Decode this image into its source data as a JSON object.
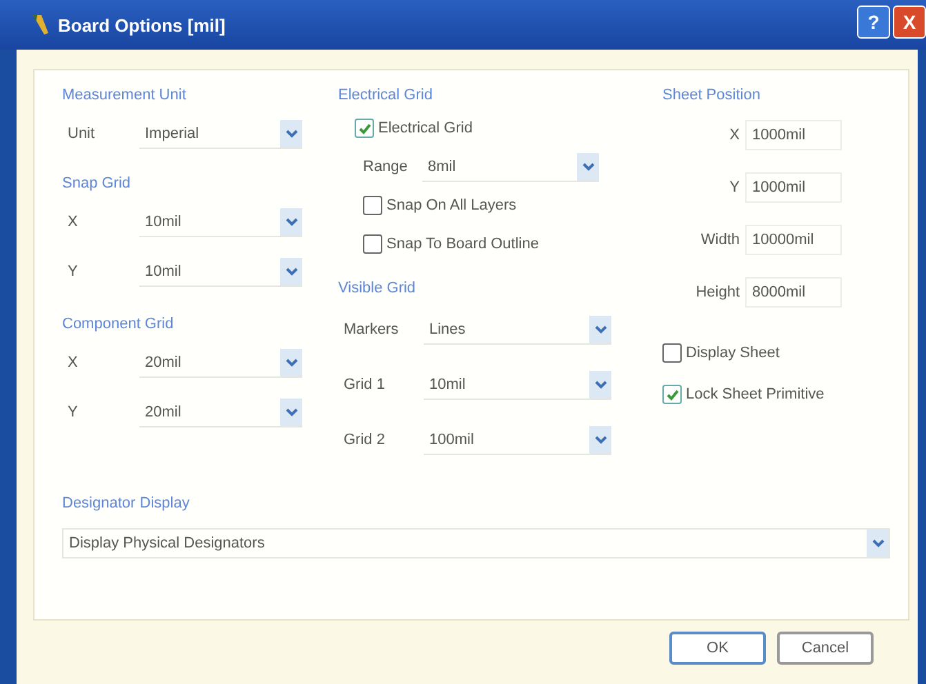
{
  "window": {
    "title": "Board Options [mil]",
    "buttons": [
      {
        "kind": "help",
        "label": "?"
      },
      {
        "kind": "close",
        "label": "X"
      }
    ]
  },
  "measurement_unit": {
    "heading": "Measurement Unit",
    "fields": [
      {
        "label": "Unit",
        "value": "Imperial"
      }
    ]
  },
  "snap_grid": {
    "heading": "Snap Grid",
    "fields": [
      {
        "label": "X",
        "value": "10mil"
      },
      {
        "label": "Y",
        "value": "10mil"
      }
    ]
  },
  "component_grid": {
    "heading": "Component Grid",
    "fields": [
      {
        "label": "X",
        "value": "20mil"
      },
      {
        "label": "Y",
        "value": "20mil"
      }
    ]
  },
  "electrical_grid": {
    "heading": "Electrical Grid",
    "items": [
      {
        "kind": "checkbox",
        "label": "Electrical Grid",
        "checked": true
      },
      {
        "kind": "dropdown",
        "label": "Range",
        "value": "8mil"
      },
      {
        "kind": "checkbox",
        "label": "Snap On All Layers",
        "checked": false
      },
      {
        "kind": "checkbox",
        "label": "Snap To Board Outline",
        "checked": false
      }
    ]
  },
  "visible_grid": {
    "heading": "Visible Grid",
    "fields": [
      {
        "label": "Markers",
        "value": "Lines"
      },
      {
        "label": "Grid 1",
        "value": "10mil"
      },
      {
        "label": "Grid 2",
        "value": "100mil"
      }
    ]
  },
  "sheet_position": {
    "heading": "Sheet Position",
    "fields": [
      {
        "label": "X",
        "value": "1000mil"
      },
      {
        "label": "Y",
        "value": "1000mil"
      },
      {
        "label": "Width",
        "value": "10000mil"
      },
      {
        "label": "Height",
        "value": "8000mil"
      }
    ],
    "checkboxes": [
      {
        "label": "Display Sheet",
        "checked": false
      },
      {
        "label": "Lock Sheet Primitive",
        "checked": true
      }
    ]
  },
  "designator_display": {
    "heading": "Designator Display",
    "value": "Display Physical Designators"
  },
  "buttons": [
    {
      "label": "OK",
      "default": true
    },
    {
      "label": "Cancel",
      "default": false
    }
  ]
}
